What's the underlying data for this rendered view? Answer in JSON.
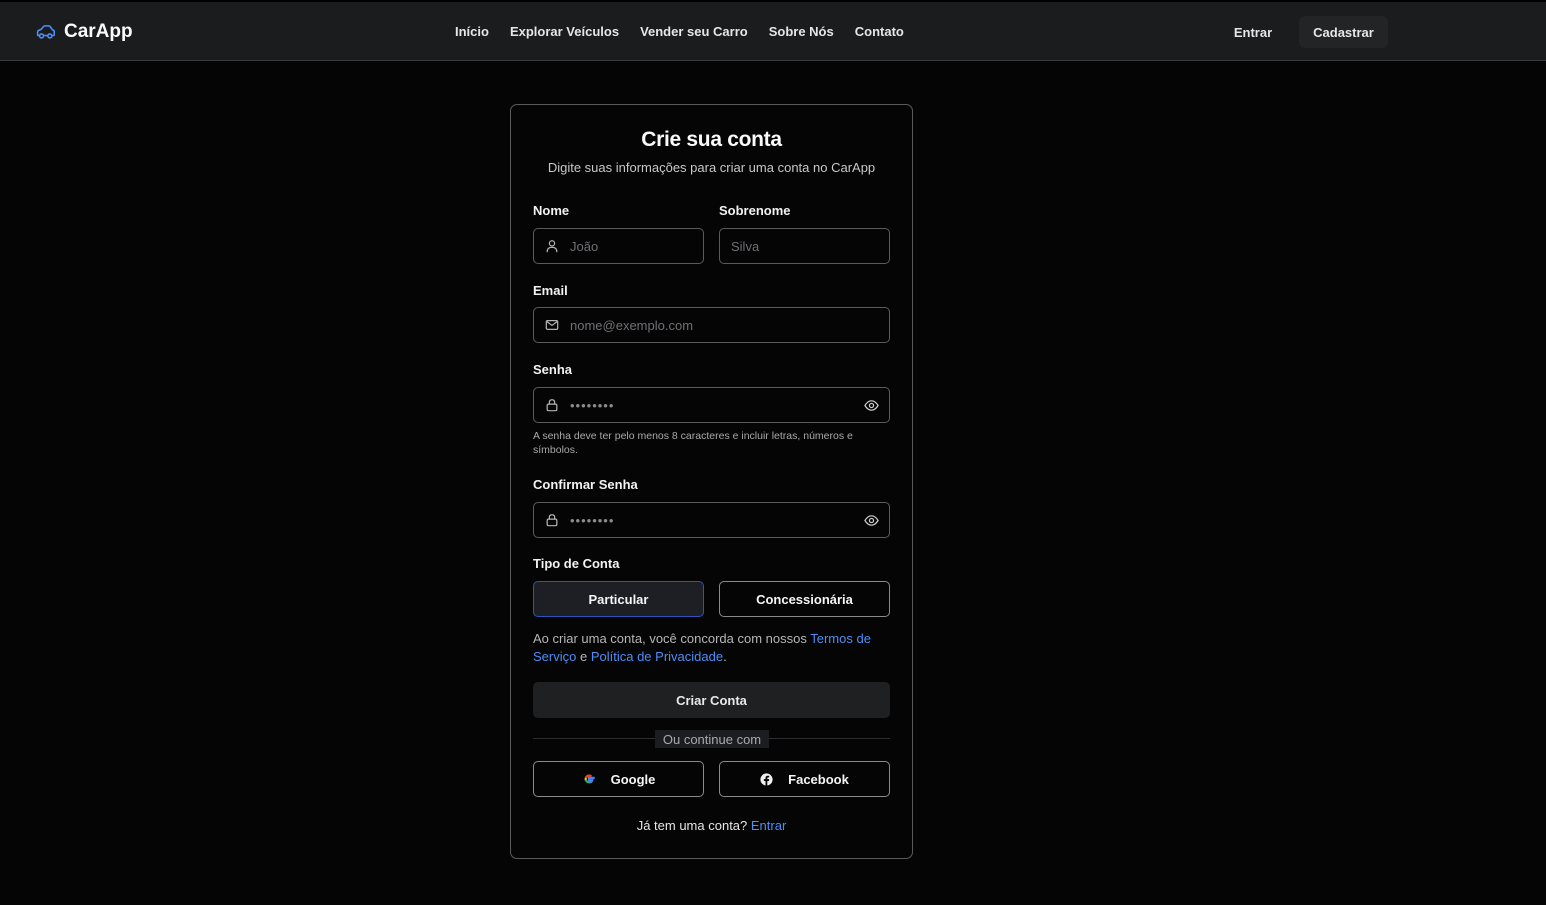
{
  "header": {
    "brand": "CarApp",
    "brand_icon": "car-icon",
    "accent": "#4d8ef5",
    "nav": [
      "Início",
      "Explorar Veículos",
      "Vender seu Carro",
      "Sobre Nós",
      "Contato"
    ],
    "login_label": "Entrar",
    "signup_label": "Cadastrar"
  },
  "form": {
    "title": "Crie sua conta",
    "subtitle": "Digite suas informações para criar uma conta no CarApp",
    "first_name": {
      "label": "Nome",
      "placeholder": "João",
      "icon": "user-icon"
    },
    "last_name": {
      "label": "Sobrenome",
      "placeholder": "Silva"
    },
    "email": {
      "label": "Email",
      "placeholder": "nome@exemplo.com",
      "icon": "mail-icon"
    },
    "password": {
      "label": "Senha",
      "masked": "••••••••",
      "icon": "lock-icon",
      "toggle_icon": "eye-icon"
    },
    "password_hint": "A senha deve ter pelo menos 8 caracteres e incluir letras, números e símbolos.",
    "confirm_password": {
      "label": "Confirmar Senha",
      "masked": "••••••••",
      "icon": "lock-icon",
      "toggle_icon": "eye-icon"
    },
    "account_type": {
      "label": "Tipo de Conta",
      "options": [
        "Particular",
        "Concessionária"
      ],
      "selected": "Particular"
    },
    "terms": {
      "prefix": "Ao criar uma conta, você concorda com nossos ",
      "terms_link": "Termos de Serviço",
      "middle": " e ",
      "privacy_link": "Política de Privacidade",
      "suffix": "."
    },
    "submit_label": "Criar Conta",
    "divider": "Ou continue com",
    "social": [
      {
        "label": "Google",
        "icon": "google-icon"
      },
      {
        "label": "Facebook",
        "icon": "facebook-icon"
      }
    ],
    "login_prompt": "Já tem uma conta?",
    "login_link": "Entrar"
  }
}
